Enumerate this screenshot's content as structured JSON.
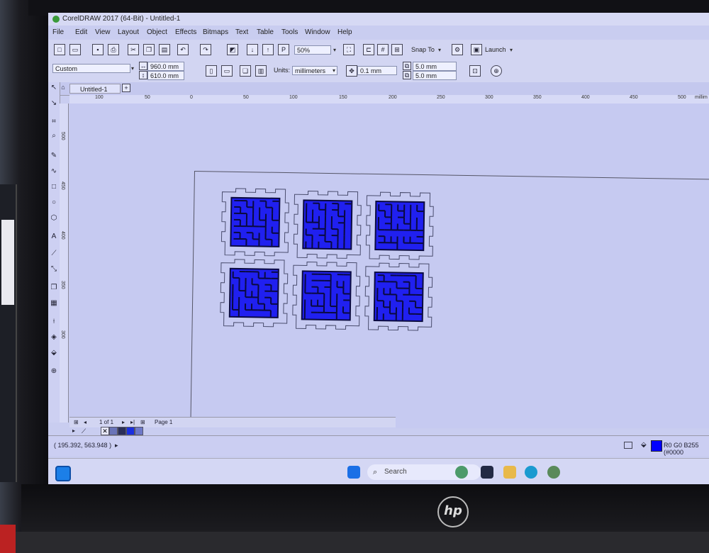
{
  "window": {
    "title": "CorelDRAW 2017 (64-Bit) - Untitled-1"
  },
  "menu": [
    "File",
    "Edit",
    "View",
    "Layout",
    "Object",
    "Effects",
    "Bitmaps",
    "Text",
    "Table",
    "Tools",
    "Window",
    "Help"
  ],
  "toolbar": {
    "zoom": "50%",
    "snap_label": "Snap To",
    "launch_label": "Launch"
  },
  "property_bar": {
    "preset": "Custom",
    "width": "960.0 mm",
    "height": "610.0 mm",
    "units_label": "Units:",
    "units": "millimeters",
    "nudge": "0.1 mm",
    "dup_x": "5.0 mm",
    "dup_y": "5.0 mm"
  },
  "doc_tab": "Untitled-1",
  "ruler_h_ticks": [
    "100",
    "50",
    "0",
    "50",
    "100",
    "150",
    "200",
    "250",
    "300",
    "350",
    "400",
    "450",
    "500",
    "millim"
  ],
  "ruler_v_ticks": [
    "500",
    "450",
    "400",
    "350",
    "300"
  ],
  "page_nav": {
    "counter": "1 of 1",
    "page_tab": "Page 1"
  },
  "status": {
    "coords": "( 195.392, 563.948 )",
    "fill_info": "R0 G0 B255 (#0000"
  },
  "taskbar": {
    "search_placeholder": "Search"
  },
  "colors": {
    "fill": "#2020f0",
    "outline": "#4a4d6e"
  },
  "maze_tile_count": 6
}
